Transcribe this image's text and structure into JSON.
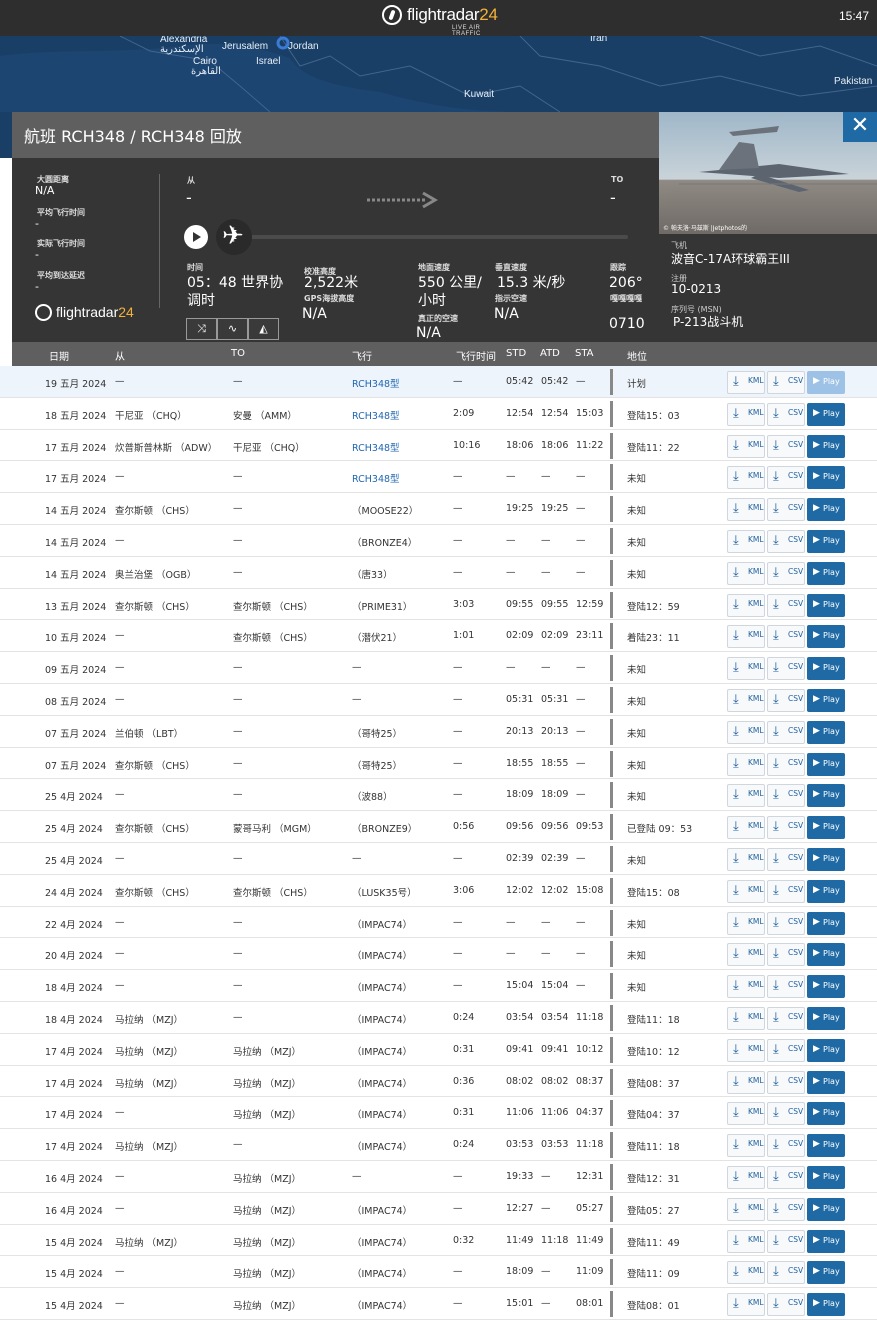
{
  "topbar": {
    "logo_text": "flightradar",
    "logo_num": "24",
    "logo_sub": "LIVE AIR TRAFFIC",
    "clock": "15:47"
  },
  "map": {
    "labels": [
      "Alexandria",
      "الإسكندرية",
      "Cairo",
      "القاهرة",
      "Jerusalem",
      "Jordan",
      "Israel",
      "Kuwait",
      "Iran",
      "Pakistan"
    ]
  },
  "panel": {
    "title": "航班 RCH348 / RCH348 回放",
    "close": "✕",
    "stats": {
      "gc_label": "大圆距离",
      "gc_value": "N/A",
      "avg_flight_label": "平均飞行时间",
      "avg_flight_value": "-",
      "actual_flight_label": "实际飞行时间",
      "actual_flight_value": "-",
      "avg_delay_label": "平均到达延迟",
      "avg_delay_value": "-"
    },
    "from_label": "从",
    "from_value": "-",
    "to_label": "TO",
    "to_value": "-",
    "logo_text": "flightradar",
    "logo_num": "24",
    "time_label": "时间",
    "time_value": "05：48 世界协调时",
    "cal_alt_label": "校准高度",
    "cal_alt_value": "2,522米",
    "gps_alt_label": "GPS海拔高度",
    "gps_alt_value": "N/A",
    "gs_label": "地面速度",
    "gs_value": "550 公里/小时",
    "tas_label": "真正的空速",
    "tas_value": "N/A",
    "vs_label": "垂直速度",
    "vs_value": "15.3 米/秒",
    "ias_label": "指示空速",
    "ias_value": "N/A",
    "track_label": "跟踪",
    "track_value": "206°",
    "squawk_label": "嘎嘎嘎嘎",
    "squawk_value": "0710",
    "aircraft_label": "飞机",
    "aircraft_value": "波音C-17A环球霸王III",
    "reg_label": "注册",
    "reg_value": "10-0213",
    "msn_label": "序列号 (MSN)",
    "msn_value": "P-213战斗机",
    "photo_credit": "© 帕夫洛·马兹斯 |Jetphotos的"
  },
  "table": {
    "headers": {
      "date": "日期",
      "from": "从",
      "to": "TO",
      "flight": "飞行",
      "duration": "飞行时间",
      "std": "STD",
      "atd": "ATD",
      "sta": "STA",
      "status": "地位"
    },
    "kml": "KML",
    "csv": "CSV",
    "play": "Play",
    "rows": [
      {
        "date": "19 五月 2024",
        "from": "—",
        "to": "—",
        "flight": "RCH348型",
        "dur": "—",
        "std": "05:42",
        "atd": "05:42",
        "sta": "—",
        "status": "计划",
        "link": true,
        "first": true
      },
      {
        "date": "18 五月 2024",
        "from": "干尼亚 （CHQ）",
        "to": "安曼 （AMM）",
        "flight": "RCH348型",
        "dur": "2:09",
        "std": "12:54",
        "atd": "12:54",
        "sta": "15:03",
        "status": "登陆15：03",
        "link": true
      },
      {
        "date": "17 五月 2024",
        "from": "炊普斯普林斯 （ADW）",
        "to": "干尼亚 （CHQ）",
        "flight": "RCH348型",
        "dur": "10:16",
        "std": "18:06",
        "atd": "18:06",
        "sta": "11:22",
        "status": "登陆11：22",
        "link": true
      },
      {
        "date": "17 五月 2024",
        "from": "—",
        "to": "—",
        "flight": "RCH348型",
        "dur": "—",
        "std": "—",
        "atd": "—",
        "sta": "—",
        "status": "未知",
        "link": true
      },
      {
        "date": "14 五月 2024",
        "from": "查尔斯顿 （CHS）",
        "to": "—",
        "flight": "（MOOSE22）",
        "dur": "—",
        "std": "19:25",
        "atd": "19:25",
        "sta": "—",
        "status": "未知"
      },
      {
        "date": "14 五月 2024",
        "from": "—",
        "to": "—",
        "flight": "（BRONZE4）",
        "dur": "—",
        "std": "—",
        "atd": "—",
        "sta": "—",
        "status": "未知"
      },
      {
        "date": "14 五月 2024",
        "from": "奥兰治堡 （OGB）",
        "to": "—",
        "flight": "（唐33）",
        "dur": "—",
        "std": "—",
        "atd": "—",
        "sta": "—",
        "status": "未知"
      },
      {
        "date": "13 五月 2024",
        "from": "查尔斯顿 （CHS）",
        "to": "查尔斯顿 （CHS）",
        "flight": "（PRIME31）",
        "dur": "3:03",
        "std": "09:55",
        "atd": "09:55",
        "sta": "12:59",
        "status": "登陆12：59"
      },
      {
        "date": "10 五月 2024",
        "from": "—",
        "to": "查尔斯顿 （CHS）",
        "flight": "（潜伏21）",
        "dur": "1:01",
        "std": "02:09",
        "atd": "02:09",
        "sta": "23:11",
        "status": "着陆23：11"
      },
      {
        "date": "09 五月 2024",
        "from": "—",
        "to": "—",
        "flight": "—",
        "dur": "—",
        "std": "—",
        "atd": "—",
        "sta": "—",
        "status": "未知",
        "flightdash": true
      },
      {
        "date": "08 五月 2024",
        "from": "—",
        "to": "—",
        "flight": "—",
        "dur": "—",
        "std": "05:31",
        "atd": "05:31",
        "sta": "—",
        "status": "未知",
        "flightdash": true
      },
      {
        "date": "07 五月 2024",
        "from": "兰伯顿 （LBT）",
        "to": "—",
        "flight": "（哥特25）",
        "dur": "—",
        "std": "20:13",
        "atd": "20:13",
        "sta": "—",
        "status": "未知"
      },
      {
        "date": "07 五月 2024",
        "from": "查尔斯顿 （CHS）",
        "to": "—",
        "flight": "（哥特25）",
        "dur": "—",
        "std": "18:55",
        "atd": "18:55",
        "sta": "—",
        "status": "未知"
      },
      {
        "date": "25 4月 2024",
        "from": "—",
        "to": "—",
        "flight": "（波88）",
        "dur": "—",
        "std": "18:09",
        "atd": "18:09",
        "sta": "—",
        "status": "未知"
      },
      {
        "date": "25 4月 2024",
        "from": "查尔斯顿 （CHS）",
        "to": "蒙哥马利 （MGM）",
        "flight": "（BRONZE9）",
        "dur": "0:56",
        "std": "09:56",
        "atd": "09:56",
        "sta": "09:53",
        "status": "已登陆 09：53"
      },
      {
        "date": "25 4月 2024",
        "from": "—",
        "to": "—",
        "flight": "—",
        "dur": "—",
        "std": "02:39",
        "atd": "02:39",
        "sta": "—",
        "status": "未知",
        "flightdash": true
      },
      {
        "date": "24 4月 2024",
        "from": "查尔斯顿 （CHS）",
        "to": "查尔斯顿 （CHS）",
        "flight": "（LUSK35号）",
        "dur": "3:06",
        "std": "12:02",
        "atd": "12:02",
        "sta": "15:08",
        "status": "登陆15：08"
      },
      {
        "date": "22 4月 2024",
        "from": "—",
        "to": "—",
        "flight": "（IMPAC74）",
        "dur": "—",
        "std": "—",
        "atd": "—",
        "sta": "—",
        "status": "未知"
      },
      {
        "date": "20 4月 2024",
        "from": "—",
        "to": "—",
        "flight": "（IMPAC74）",
        "dur": "—",
        "std": "—",
        "atd": "—",
        "sta": "—",
        "status": "未知"
      },
      {
        "date": "18 4月 2024",
        "from": "—",
        "to": "—",
        "flight": "（IMPAC74）",
        "dur": "—",
        "std": "15:04",
        "atd": "15:04",
        "sta": "—",
        "status": "未知"
      },
      {
        "date": "18 4月 2024",
        "from": "马拉纳 （MZJ）",
        "to": "—",
        "flight": "（IMPAC74）",
        "dur": "0:24",
        "std": "03:54",
        "atd": "03:54",
        "sta": "11:18",
        "status": "登陆11：18"
      },
      {
        "date": "17 4月 2024",
        "from": "马拉纳 （MZJ）",
        "to": "马拉纳 （MZJ）",
        "flight": "（IMPAC74）",
        "dur": "0:31",
        "std": "09:41",
        "atd": "09:41",
        "sta": "10:12",
        "status": "登陆10：12"
      },
      {
        "date": "17 4月 2024",
        "from": "马拉纳 （MZJ）",
        "to": "马拉纳 （MZJ）",
        "flight": "（IMPAC74）",
        "dur": "0:36",
        "std": "08:02",
        "atd": "08:02",
        "sta": "08:37",
        "status": "登陆08：37"
      },
      {
        "date": "17 4月 2024",
        "from": "—",
        "to": "马拉纳 （MZJ）",
        "flight": "（IMPAC74）",
        "dur": "0:31",
        "std": "11:06",
        "atd": "11:06",
        "sta": "04:37",
        "status": "登陆04：37"
      },
      {
        "date": "17 4月 2024",
        "from": "马拉纳 （MZJ）",
        "to": "—",
        "flight": "（IMPAC74）",
        "dur": "0:24",
        "std": "03:53",
        "atd": "03:53",
        "sta": "11:18",
        "status": "登陆11：18"
      },
      {
        "date": "16 4月 2024",
        "from": "—",
        "to": "马拉纳 （MZJ）",
        "flight": "—",
        "dur": "—",
        "std": "19:33",
        "atd": "—",
        "sta": "12:31",
        "status": "登陆12：31",
        "flightdash": true
      },
      {
        "date": "16 4月 2024",
        "from": "—",
        "to": "马拉纳 （MZJ）",
        "flight": "（IMPAC74）",
        "dur": "—",
        "std": "12:27",
        "atd": "—",
        "sta": "05:27",
        "status": "登陆05：27"
      },
      {
        "date": "15 4月 2024",
        "from": "马拉纳 （MZJ）",
        "to": "马拉纳 （MZJ）",
        "flight": "（IMPAC74）",
        "dur": "0:32",
        "std": "11:49",
        "atd": "11:18",
        "sta": "11:49",
        "status": "登陆11：49"
      },
      {
        "date": "15 4月 2024",
        "from": "—",
        "to": "马拉纳 （MZJ）",
        "flight": "（IMPAC74）",
        "dur": "—",
        "std": "18:09",
        "atd": "—",
        "sta": "11:09",
        "status": "登陆11：09"
      },
      {
        "date": "15 4月 2024",
        "from": "—",
        "to": "马拉纳 （MZJ）",
        "flight": "（IMPAC74）",
        "dur": "—",
        "std": "15:01",
        "atd": "—",
        "sta": "08:01",
        "status": "登陆08：01"
      }
    ]
  }
}
